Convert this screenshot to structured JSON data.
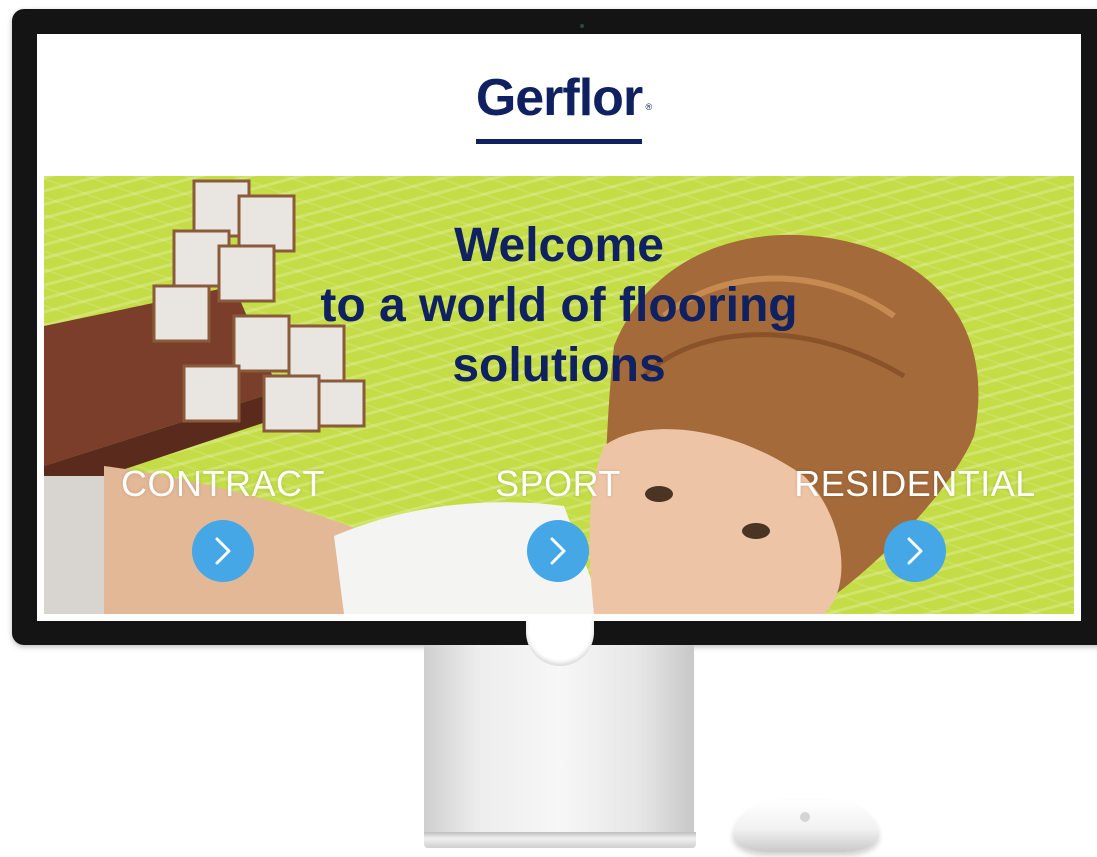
{
  "brand": {
    "name": "Gerflor",
    "registered": "®",
    "color": "#0f2160"
  },
  "hero": {
    "title_lines": [
      "Welcome",
      "to a world of flooring",
      "solutions"
    ],
    "background_color": "#c4dc46",
    "categories": [
      {
        "label": "CONTRACT",
        "icon": "chevron-right-icon"
      },
      {
        "label": "SPORT",
        "icon": "chevron-right-icon"
      },
      {
        "label": "RESIDENTIAL",
        "icon": "chevron-right-icon"
      }
    ],
    "button_color": "#45a7e6"
  }
}
